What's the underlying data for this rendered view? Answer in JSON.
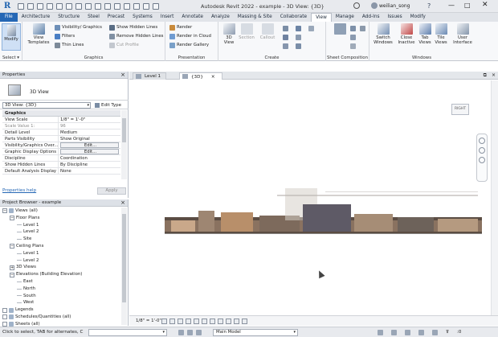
{
  "title_bar": {
    "app_letter": "R",
    "window_title": "Autodesk Revit 2022 - example - 3D View: {3D}",
    "user_name": "weilian_song",
    "help_glyph": "?",
    "min_glyph": "—",
    "max_glyph": "□",
    "close_glyph": "✕"
  },
  "ribbon_tabs": [
    "File",
    "Architecture",
    "Structure",
    "Steel",
    "Precast",
    "Systems",
    "Insert",
    "Annotate",
    "Analyze",
    "Massing & Site",
    "Collaborate",
    "View",
    "Manage",
    "Add-Ins",
    "Issues",
    "Modify"
  ],
  "active_tab": "View",
  "ribbon": {
    "select_panel": {
      "modify_label": "Modify",
      "title": "Select ▾"
    },
    "graphics_panel": {
      "title": "Graphics",
      "view_templates": "View Templates",
      "visibility_graphics": "Visibility/ Graphics",
      "filters": "Filters",
      "thin_lines": "Thin Lines",
      "show_hidden_lines": "Show Hidden Lines",
      "remove_hidden_lines": "Remove Hidden Lines",
      "cut_profile": "Cut Profile"
    },
    "presentation_panel": {
      "title": "Presentation",
      "render": "Render",
      "render_in_cloud": "Render in Cloud",
      "render_gallery": "Render Gallery"
    },
    "create_panel": {
      "title": "Create",
      "view_3d": "3D View",
      "section": "Section",
      "callout": "Callout"
    },
    "sheet_panel": {
      "title": "Sheet Composition"
    },
    "windows_panel": {
      "title": "Windows",
      "switch_windows": "Switch Windows",
      "close_inactive": "Close Inactive",
      "tab_views": "Tab Views",
      "tile_views": "Tile Views",
      "user_interface": "User Interface"
    }
  },
  "properties": {
    "header": "Properties",
    "type_name": "3D View",
    "instance_selector": "3D View: {3D}",
    "edit_type": "Edit Type",
    "rows": [
      {
        "key": "Graphics",
        "value": "",
        "group": true
      },
      {
        "key": "View Scale",
        "value": "1/8\" = 1'-0\""
      },
      {
        "key": "Scale Value    1:",
        "value": "96",
        "muted": true
      },
      {
        "key": "Detail Level",
        "value": "Medium"
      },
      {
        "key": "Parts Visibility",
        "value": "Show Original"
      },
      {
        "key": "Visibility/Graphics Over...",
        "value": "Edit...",
        "button": true
      },
      {
        "key": "Graphic Display Options",
        "value": "Edit...",
        "button": true
      },
      {
        "key": "Discipline",
        "value": "Coordination"
      },
      {
        "key": "Show Hidden Lines",
        "value": "By Discipline"
      },
      {
        "key": "Default Analysis Display",
        "value": "None"
      }
    ],
    "help_link": "Properties help",
    "apply_button": "Apply"
  },
  "project_browser": {
    "header": "Project Browser - example",
    "nodes": [
      {
        "label": "Views (all)",
        "level": 0,
        "toggle": "−",
        "icon": true
      },
      {
        "label": "Floor Plans",
        "level": 1,
        "toggle": "−"
      },
      {
        "label": "Level 1",
        "level": 2
      },
      {
        "label": "Level 2",
        "level": 2
      },
      {
        "label": "Site",
        "level": 2
      },
      {
        "label": "Ceiling Plans",
        "level": 1,
        "toggle": "−"
      },
      {
        "label": "Level 1",
        "level": 2
      },
      {
        "label": "Level 2",
        "level": 2
      },
      {
        "label": "3D Views",
        "level": 1,
        "toggle": "+"
      },
      {
        "label": "Elevations (Building Elevation)",
        "level": 1,
        "toggle": "−"
      },
      {
        "label": "East",
        "level": 2
      },
      {
        "label": "North",
        "level": 2
      },
      {
        "label": "South",
        "level": 2
      },
      {
        "label": "West",
        "level": 2
      },
      {
        "label": "Legends",
        "level": 0,
        "toggle": "",
        "icon": true
      },
      {
        "label": "Schedules/Quantities (all)",
        "level": 0,
        "toggle": "",
        "icon": true
      },
      {
        "label": "Sheets (all)",
        "level": 0,
        "toggle": "",
        "icon": true
      }
    ]
  },
  "view_tabs": [
    {
      "label": "Level 1",
      "active": false
    },
    {
      "label": "{3D}",
      "active": true
    }
  ],
  "view_cube_label": "RIGHT",
  "view_control_bar": {
    "scale": "1/8\" = 1'-0\""
  },
  "status_bar": {
    "hint": "Click to select, TAB for alternates, C",
    "model": "Main Model",
    "filter_count": ":0"
  },
  "colors": {
    "accent": "#2567b5",
    "ribbon_bg": "#f7f8fa"
  }
}
